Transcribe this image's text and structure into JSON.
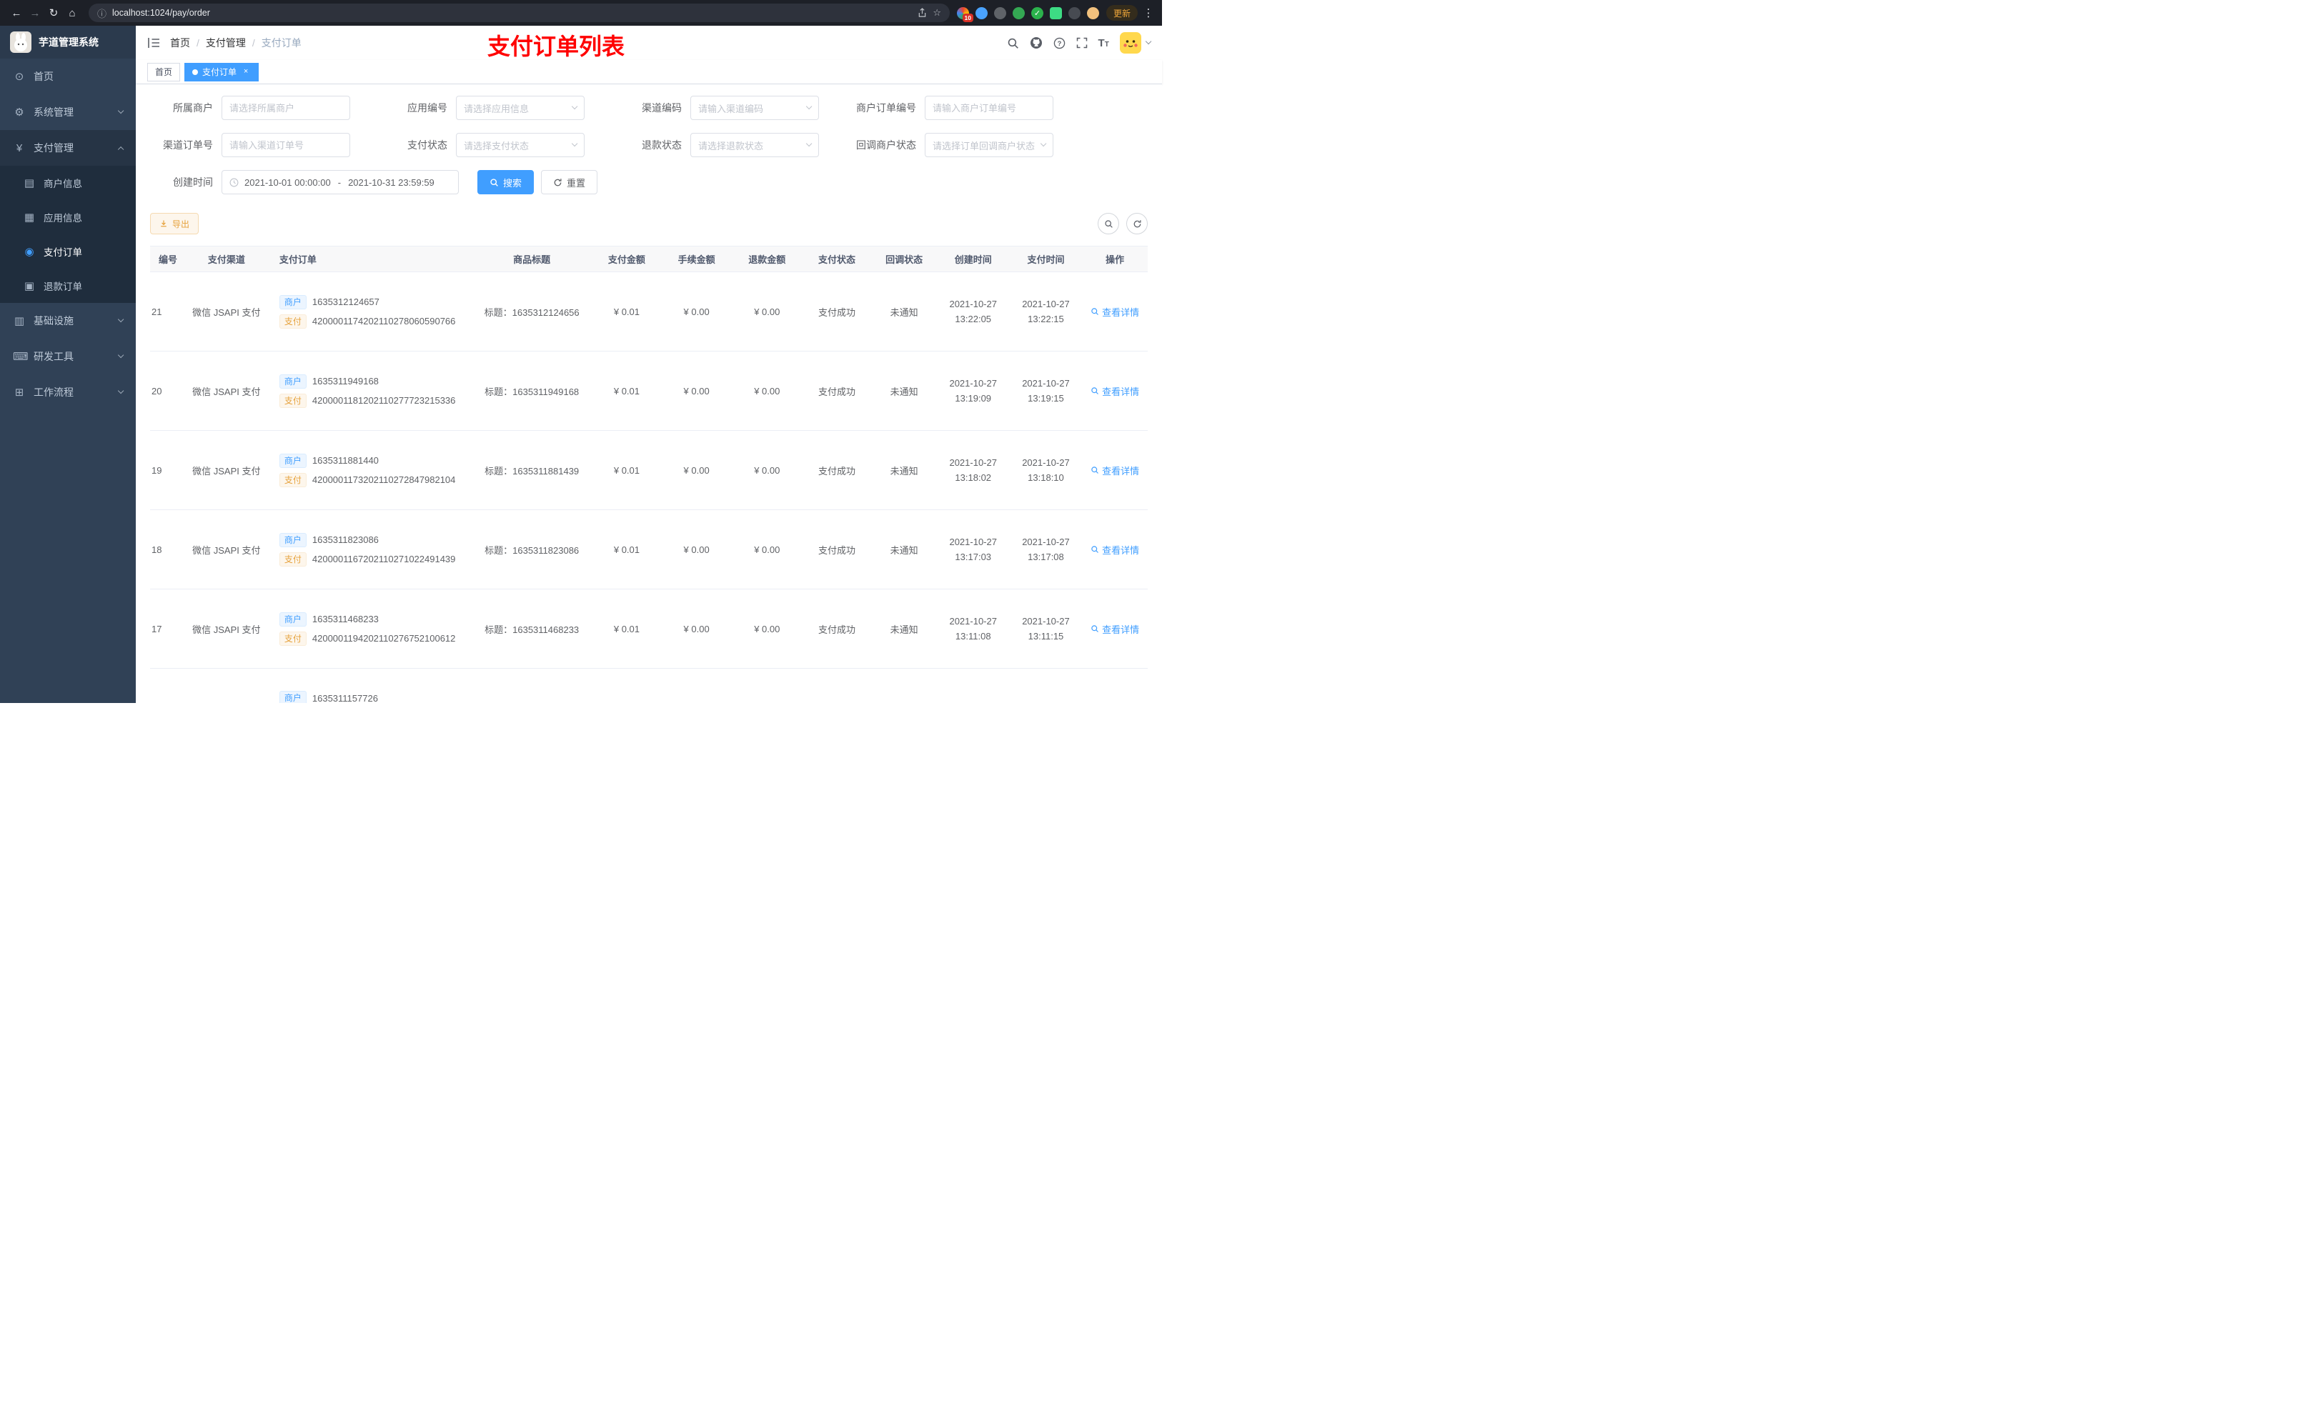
{
  "browser": {
    "url": "localhost:1024/pay/order",
    "ext_badge": "10",
    "ext_check": "✓",
    "update_label": "更新"
  },
  "sidebar": {
    "logo_title": "芋道管理系统",
    "menu": {
      "home": "首页",
      "system": "系统管理",
      "pay": "支付管理",
      "merchant_info": "商户信息",
      "app_info": "应用信息",
      "pay_order": "支付订单",
      "refund_order": "退款订单",
      "infra": "基础设施",
      "dev_tools": "研发工具",
      "workflow": "工作流程"
    }
  },
  "header": {
    "breadcrumb": {
      "home": "首页",
      "sep": "/",
      "section": "支付管理",
      "page": "支付订单"
    },
    "annotation": "支付订单列表"
  },
  "tabs": {
    "home": "首页",
    "current": "支付订单",
    "close": "×"
  },
  "filters": {
    "merchant": {
      "label": "所属商户",
      "placeholder": "请选择所属商户"
    },
    "app": {
      "label": "应用编号",
      "placeholder": "请选择应用信息"
    },
    "channel_code": {
      "label": "渠道编码",
      "placeholder": "请输入渠道编码"
    },
    "merchant_order_no": {
      "label": "商户订单编号",
      "placeholder": "请输入商户订单编号"
    },
    "channel_order_no": {
      "label": "渠道订单号",
      "placeholder": "请输入渠道订单号"
    },
    "pay_status": {
      "label": "支付状态",
      "placeholder": "请选择支付状态"
    },
    "refund_status": {
      "label": "退款状态",
      "placeholder": "请选择退款状态"
    },
    "notify_status": {
      "label": "回调商户状态",
      "placeholder": "请选择订单回调商户状态"
    },
    "create_time": {
      "label": "创建时间",
      "start": "2021-10-01 00:00:00",
      "separator": "-",
      "end": "2021-10-31 23:59:59"
    },
    "search_label": "搜索",
    "reset_label": "重置"
  },
  "toolbar": {
    "export_label": "导出"
  },
  "table": {
    "tag_merchant": "商户",
    "tag_pay": "支付",
    "columns": [
      "编号",
      "支付渠道",
      "支付订单",
      "商品标题",
      "支付金额",
      "手续金额",
      "退款金额",
      "支付状态",
      "回调状态",
      "创建时间",
      "支付时间",
      "操作"
    ],
    "rows": [
      {
        "id": "21",
        "channel": "微信 JSAPI 支付",
        "merchant_no": "1635312124657",
        "pay_no": "4200001174202110278060590766",
        "title": "标题：1635312124656",
        "amount": "¥ 0.01",
        "fee": "¥ 0.00",
        "refund": "¥ 0.00",
        "status": "支付成功",
        "notify": "未通知",
        "create_date": "2021-10-27",
        "create_time": "13:22:05",
        "pay_date": "2021-10-27",
        "pay_time": "13:22:15",
        "action": "查看详情"
      },
      {
        "id": "20",
        "channel": "微信 JSAPI 支付",
        "merchant_no": "1635311949168",
        "pay_no": "4200001181202110277723215336",
        "title": "标题：1635311949168",
        "amount": "¥ 0.01",
        "fee": "¥ 0.00",
        "refund": "¥ 0.00",
        "status": "支付成功",
        "notify": "未通知",
        "create_date": "2021-10-27",
        "create_time": "13:19:09",
        "pay_date": "2021-10-27",
        "pay_time": "13:19:15",
        "action": "查看详情"
      },
      {
        "id": "19",
        "channel": "微信 JSAPI 支付",
        "merchant_no": "1635311881440",
        "pay_no": "4200001173202110272847982104",
        "title": "标题：1635311881439",
        "amount": "¥ 0.01",
        "fee": "¥ 0.00",
        "refund": "¥ 0.00",
        "status": "支付成功",
        "notify": "未通知",
        "create_date": "2021-10-27",
        "create_time": "13:18:02",
        "pay_date": "2021-10-27",
        "pay_time": "13:18:10",
        "action": "查看详情"
      },
      {
        "id": "18",
        "channel": "微信 JSAPI 支付",
        "merchant_no": "1635311823086",
        "pay_no": "4200001167202110271022491439",
        "title": "标题：1635311823086",
        "amount": "¥ 0.01",
        "fee": "¥ 0.00",
        "refund": "¥ 0.00",
        "status": "支付成功",
        "notify": "未通知",
        "create_date": "2021-10-27",
        "create_time": "13:17:03",
        "pay_date": "2021-10-27",
        "pay_time": "13:17:08",
        "action": "查看详情"
      },
      {
        "id": "17",
        "channel": "微信 JSAPI 支付",
        "merchant_no": "1635311468233",
        "pay_no": "4200001194202110276752100612",
        "title": "标题：1635311468233",
        "amount": "¥ 0.01",
        "fee": "¥ 0.00",
        "refund": "¥ 0.00",
        "status": "支付成功",
        "notify": "未通知",
        "create_date": "2021-10-27",
        "create_time": "13:11:08",
        "pay_date": "2021-10-27",
        "pay_time": "13:11:15",
        "action": "查看详情"
      },
      {
        "id": "",
        "channel": "",
        "merchant_no": "1635311157726",
        "pay_no": "",
        "title": "",
        "amount": "",
        "fee": "",
        "refund": "",
        "status": "",
        "notify": "",
        "create_date": "",
        "create_time": "",
        "pay_date": "",
        "pay_time": "",
        "action": "",
        "partial": true
      }
    ]
  }
}
